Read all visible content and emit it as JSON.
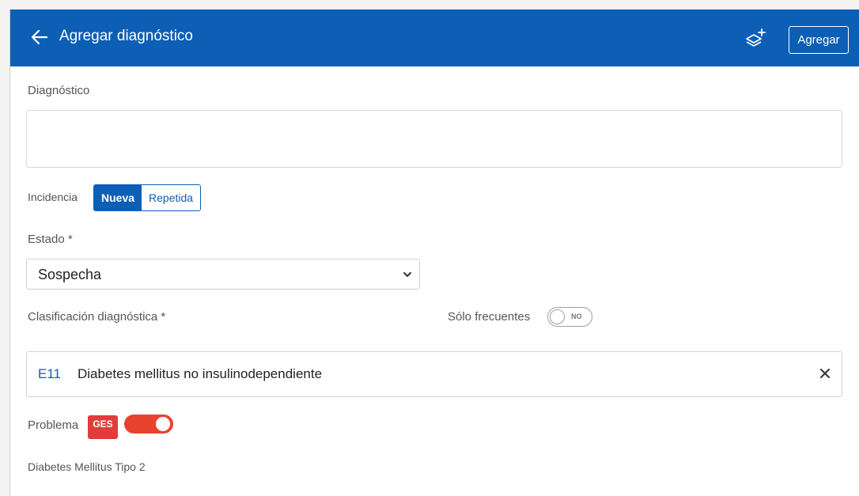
{
  "header": {
    "title": "Agregar diagnóstico",
    "add_button": "Agregar",
    "icons": {
      "back": "arrow-left-icon",
      "layers": "layers-add-icon"
    }
  },
  "form": {
    "diagnosis": {
      "label": "Diagnóstico",
      "value": ""
    },
    "incidence": {
      "label": "Incidencia",
      "options": [
        "Nueva",
        "Repetida"
      ],
      "selected": "Nueva"
    },
    "status": {
      "label": "Estado *",
      "value": "Sospecha"
    },
    "classification": {
      "label": "Clasificación diagnóstica *",
      "frequent_label": "Sólo frecuentes",
      "frequent_toggle": "NO",
      "code": "E11",
      "description": "Diabetes mellitus no insulinodependiente"
    },
    "problem": {
      "label": "Problema",
      "badge": "GES",
      "toggle_on": true
    },
    "ges_name": "Diabetes Mellitus Tipo 2"
  },
  "colors": {
    "primary": "#0d5fb5",
    "ges": "#e23b3b",
    "toggle_on": "#e8432f"
  }
}
